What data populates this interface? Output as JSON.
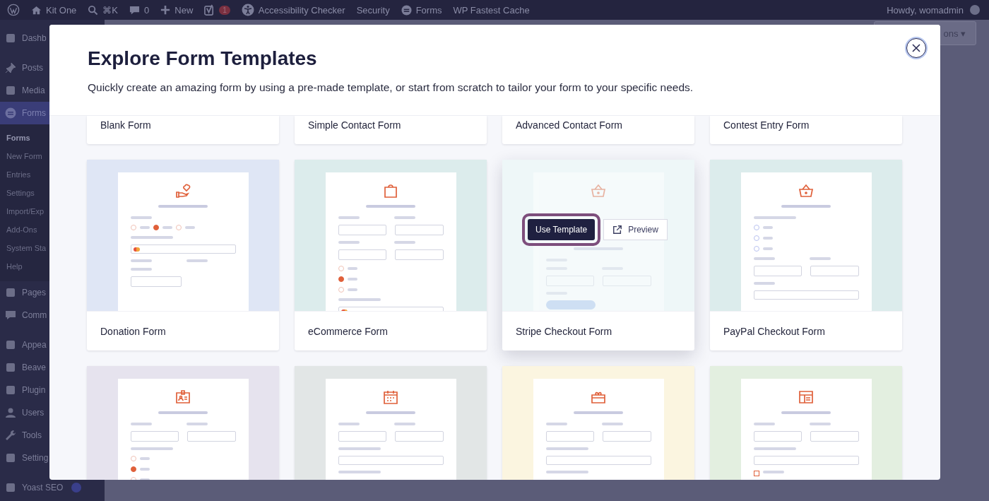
{
  "admin_bar": {
    "site": "Kit One",
    "search_shortcut": "⌘K",
    "comments": "0",
    "new": "New",
    "seo_badge": "1",
    "links": [
      "Accessibility Checker",
      "Security",
      "Forms",
      "WP Fastest Cache"
    ],
    "greeting": "Howdy, womadmin"
  },
  "sidebar": {
    "items": [
      {
        "label": "Dashb",
        "selected": false
      },
      {
        "label": "Posts",
        "selected": false
      },
      {
        "label": "Media",
        "selected": false
      },
      {
        "label": "Forms",
        "selected": true,
        "children": [
          {
            "label": "Forms",
            "selected": true
          },
          {
            "label": "New Form",
            "selected": false
          },
          {
            "label": "Entries",
            "selected": false
          },
          {
            "label": "Settings",
            "selected": false
          },
          {
            "label": "Import/Exp",
            "selected": false
          },
          {
            "label": "Add-Ons",
            "selected": false
          },
          {
            "label": "System Sta",
            "selected": false
          },
          {
            "label": "Help",
            "selected": false
          }
        ]
      },
      {
        "label": "Pages",
        "selected": false
      },
      {
        "label": "Comm",
        "selected": false
      },
      {
        "label": "Appea",
        "selected": false
      },
      {
        "label": "Beave",
        "selected": false
      },
      {
        "label": "Plugin",
        "selected": false
      },
      {
        "label": "Users",
        "selected": false
      },
      {
        "label": "Tools",
        "selected": false
      },
      {
        "label": "Setting",
        "selected": false
      },
      {
        "label": "Yoast SEO",
        "selected": false
      }
    ]
  },
  "screen_options": "ons ▾",
  "modal": {
    "title": "Explore Form Templates",
    "subtitle": "Quickly create an amazing form by using a pre-made template, or start from scratch to tailor your form to your specific needs.",
    "hover_actions": [
      {
        "label": "Use Template",
        "kind": "primary",
        "focused": true
      },
      {
        "label": "Preview",
        "kind": "secondary",
        "focused": false
      }
    ],
    "top_row": [
      "Blank Form",
      "Simple Contact Form",
      "Advanced Contact Form",
      "Contest Entry Form"
    ],
    "templates": [
      {
        "title": "Donation Form",
        "color": "#dfe6f5",
        "hovered": false
      },
      {
        "title": "eCommerce Form",
        "color": "#dcecec",
        "hovered": false
      },
      {
        "title": "Stripe Checkout Form",
        "color": "#dcecec",
        "hovered": true
      },
      {
        "title": "PayPal Checkout Form",
        "color": "#dcecec",
        "hovered": false
      },
      {
        "color": "#e6e3ee",
        "hovered": false
      },
      {
        "color": "#e2e6e6",
        "hovered": false
      },
      {
        "color": "#fbf5e0",
        "hovered": false
      },
      {
        "color": "#e3efe0",
        "hovered": false
      }
    ]
  }
}
